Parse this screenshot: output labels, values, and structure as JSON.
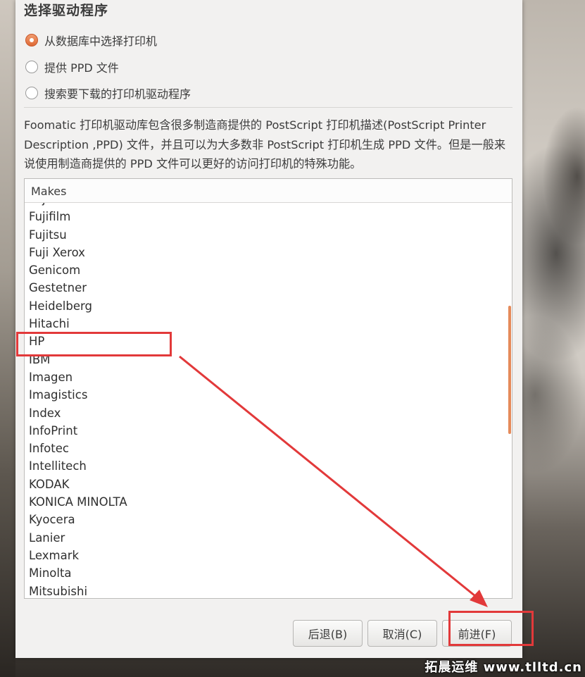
{
  "dialog": {
    "title": "选择驱动程序",
    "options": [
      {
        "label": "从数据库中选择打印机",
        "checked": true
      },
      {
        "label": "提供 PPD 文件",
        "checked": false
      },
      {
        "label": "搜索要下载的打印机驱动程序",
        "checked": false
      }
    ],
    "description": "Foomatic 打印机驱动库包含很多制造商提供的 PostScript 打印机描述(PostScript Printer Description ,PPD) 文件，并且可以为大多数非 PostScript 打印机生成 PPD 文件。但是一般来说使用制造商提供的 PPD 文件可以更好的访问打印机的特殊功能。",
    "list": {
      "column_header": "Makes",
      "items": [
        "Fuji",
        "Fujifilm",
        "Fujitsu",
        "Fuji Xerox",
        "Genicom",
        "Gestetner",
        "Heidelberg",
        "Hitachi",
        "HP",
        "IBM",
        "Imagen",
        "Imagistics",
        "Index",
        "InfoPrint",
        "Infotec",
        "Intellitech",
        "KODAK",
        "KONICA MINOLTA",
        "Kyocera",
        "Lanier",
        "Lexmark",
        "Minolta",
        "Mitsubishi"
      ],
      "highlighted_item": "HP"
    },
    "buttons": {
      "back": "后退(B)",
      "cancel": "取消(C)",
      "forward": "前进(F)"
    }
  },
  "colors": {
    "accent": "#df6a36",
    "annotation": "#e2393a"
  },
  "watermark": "拓晨运维 www.tlltd.cn"
}
